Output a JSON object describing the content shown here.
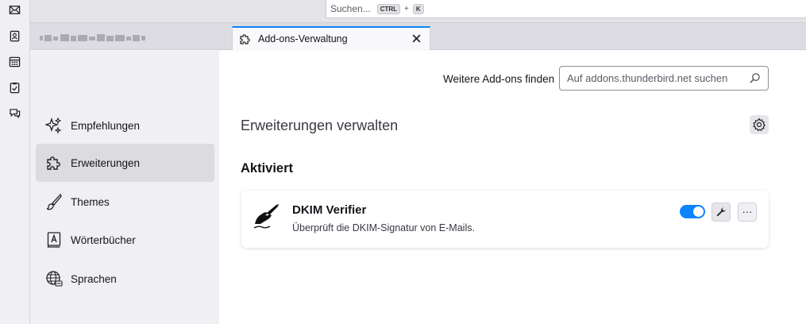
{
  "search": {
    "placeholder": "Suchen...",
    "key1": "CTRL",
    "plus": "+",
    "key2": "K"
  },
  "tab": {
    "title": "Add-ons-Verwaltung"
  },
  "sidebar": {
    "items": [
      {
        "label": "Empfehlungen",
        "icon": "sparkles-icon"
      },
      {
        "label": "Erweiterungen",
        "icon": "puzzle-icon",
        "selected": true
      },
      {
        "label": "Themes",
        "icon": "brush-icon"
      },
      {
        "label": "Wörterbücher",
        "icon": "dictionary-icon"
      },
      {
        "label": "Sprachen",
        "icon": "globe-icon"
      }
    ]
  },
  "main": {
    "find_label": "Weitere Add-ons finden",
    "find_placeholder": "Auf addons.thunderbird.net suchen",
    "heading": "Erweiterungen verwalten",
    "section": "Aktiviert",
    "extension": {
      "name": "DKIM Verifier",
      "description": "Überprüft die DKIM-Signatur von E-Mails.",
      "enabled": true,
      "more_label": "···"
    }
  },
  "colors": {
    "accent": "#0a84ff",
    "sidebar_bg": "#f0f0f4",
    "selected_bg": "#dcdce0"
  }
}
